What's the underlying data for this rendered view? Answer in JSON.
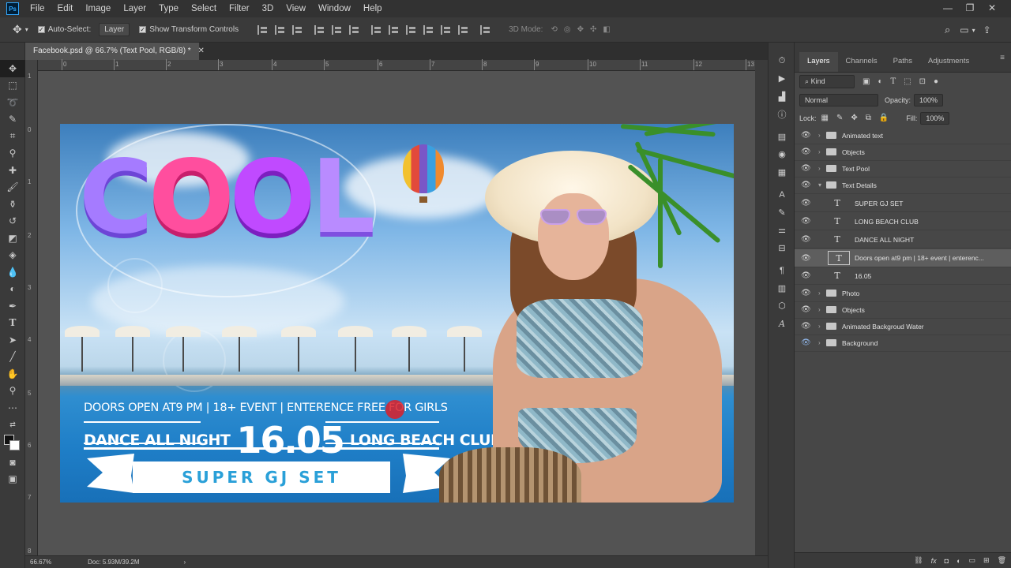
{
  "app": {
    "logo": "Ps",
    "menu": [
      "File",
      "Edit",
      "Image",
      "Layer",
      "Type",
      "Select",
      "Filter",
      "3D",
      "View",
      "Window",
      "Help"
    ],
    "window_controls": [
      "—",
      "❐",
      "✕"
    ]
  },
  "options_bar": {
    "auto_select_label": "Auto-Select:",
    "auto_select_value": "Layer",
    "show_transform_label": "Show Transform Controls",
    "mode_3d_label": "3D Mode:"
  },
  "document": {
    "tab_title": "Facebook.psd @ 66.7% (Text Pool, RGB/8) *",
    "zoom": "66.67%",
    "doc_size": "Doc: 5.93M/39.2M",
    "ruler_marks": [
      "0",
      "1",
      "2",
      "3",
      "4",
      "5",
      "6",
      "7",
      "8",
      "9",
      "10",
      "11",
      "12",
      "13"
    ],
    "ruler_v_marks": [
      "1",
      "0",
      "1",
      "2",
      "3",
      "4",
      "5",
      "6",
      "7",
      "8"
    ]
  },
  "artwork": {
    "headline_letters": [
      "C",
      "O",
      "O",
      "L"
    ],
    "info_line": "DOORS OPEN AT9 PM | 18+ EVENT | ENTERENCE FREE FOR GIRLS",
    "dance": "DANCE ALL NIGHT",
    "date": "16.05",
    "club": "LONG BEACH CLUB",
    "ribbon": "SUPER GJ SET"
  },
  "layers_panel": {
    "tabs": [
      "Layers",
      "Channels",
      "Paths",
      "Adjustments"
    ],
    "filter_kind": "Kind",
    "blend_mode": "Normal",
    "opacity_label": "Opacity:",
    "opacity_value": "100%",
    "lock_label": "Lock:",
    "fill_label": "Fill:",
    "fill_value": "100%",
    "layers": [
      {
        "name": "Animated text",
        "type": "group",
        "expanded": false
      },
      {
        "name": "Objects",
        "type": "group",
        "expanded": false
      },
      {
        "name": "Text Pool",
        "type": "group",
        "expanded": false
      },
      {
        "name": "Text Details",
        "type": "group",
        "expanded": true
      },
      {
        "name": "SUPER GJ SET",
        "type": "text",
        "child": true
      },
      {
        "name": "LONG BEACH CLUB",
        "type": "text",
        "child": true
      },
      {
        "name": "DANCE ALL NIGHT",
        "type": "text",
        "child": true
      },
      {
        "name": "Doors open at9 pm | 18+ event | enterenc...",
        "type": "text",
        "child": true,
        "selected": true
      },
      {
        "name": "16.05",
        "type": "text",
        "child": true
      },
      {
        "name": "Photo",
        "type": "group",
        "expanded": false
      },
      {
        "name": "Objects",
        "type": "group",
        "expanded": false
      },
      {
        "name": "Animated Backgroud Water",
        "type": "group",
        "expanded": false
      },
      {
        "name": "Background",
        "type": "group",
        "expanded": false,
        "highlight": true
      }
    ]
  }
}
